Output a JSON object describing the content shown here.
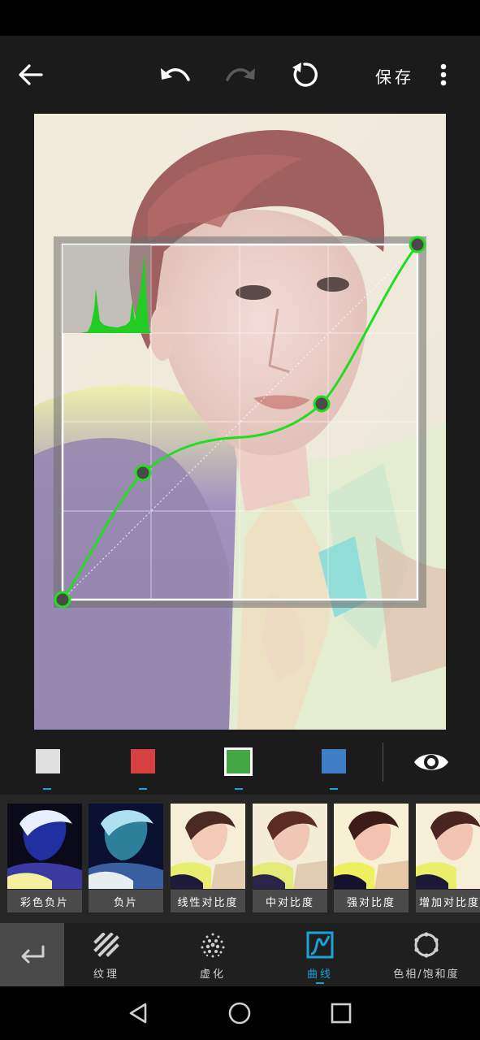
{
  "toolbar": {
    "back_icon": "arrow-left-icon",
    "undo_icon": "undo-icon",
    "redo_icon": "redo-icon",
    "reset_icon": "rotate-reset-icon",
    "save_label": "保存",
    "more_icon": "vertical-dots-icon"
  },
  "photo": {
    "description_icon": "portrait-photo"
  },
  "curve_editor": {
    "active_channel": "green",
    "curve_color": "#22dd22",
    "points": [
      [
        0,
        0
      ],
      [
        0.227,
        0.357
      ],
      [
        0.727,
        0.553
      ],
      [
        1,
        1
      ]
    ]
  },
  "channels": [
    {
      "name": "rgb",
      "color": "#e0e0e0",
      "selected": false
    },
    {
      "name": "red",
      "color": "#d94040",
      "selected": false
    },
    {
      "name": "green",
      "color": "#43a843",
      "selected": true
    },
    {
      "name": "blue",
      "color": "#3f7ec6",
      "selected": false
    }
  ],
  "preview_icon": "eye-icon",
  "filters": [
    {
      "label": "彩色负片"
    },
    {
      "label": "负片"
    },
    {
      "label": "线性对比度"
    },
    {
      "label": "中对比度"
    },
    {
      "label": "强对比度"
    },
    {
      "label": "增加对比度"
    }
  ],
  "tools": {
    "back_icon": "enter-return-icon",
    "items": [
      {
        "label": "纹理",
        "icon": "texture-stripes-icon",
        "active": false
      },
      {
        "label": "虚化",
        "icon": "blur-dots-icon",
        "active": false
      },
      {
        "label": "曲线",
        "icon": "curve-icon",
        "active": true
      },
      {
        "label": "色相/饱和度",
        "icon": "hue-ring-icon",
        "active": false
      }
    ]
  },
  "navbar": {
    "back_icon": "triangle-back-icon",
    "home_icon": "circle-home-icon",
    "recents_icon": "square-recents-icon"
  },
  "colors": {
    "accent": "#1aa3d9",
    "curve_green": "#22dd22",
    "background": "#1b1b1b"
  }
}
